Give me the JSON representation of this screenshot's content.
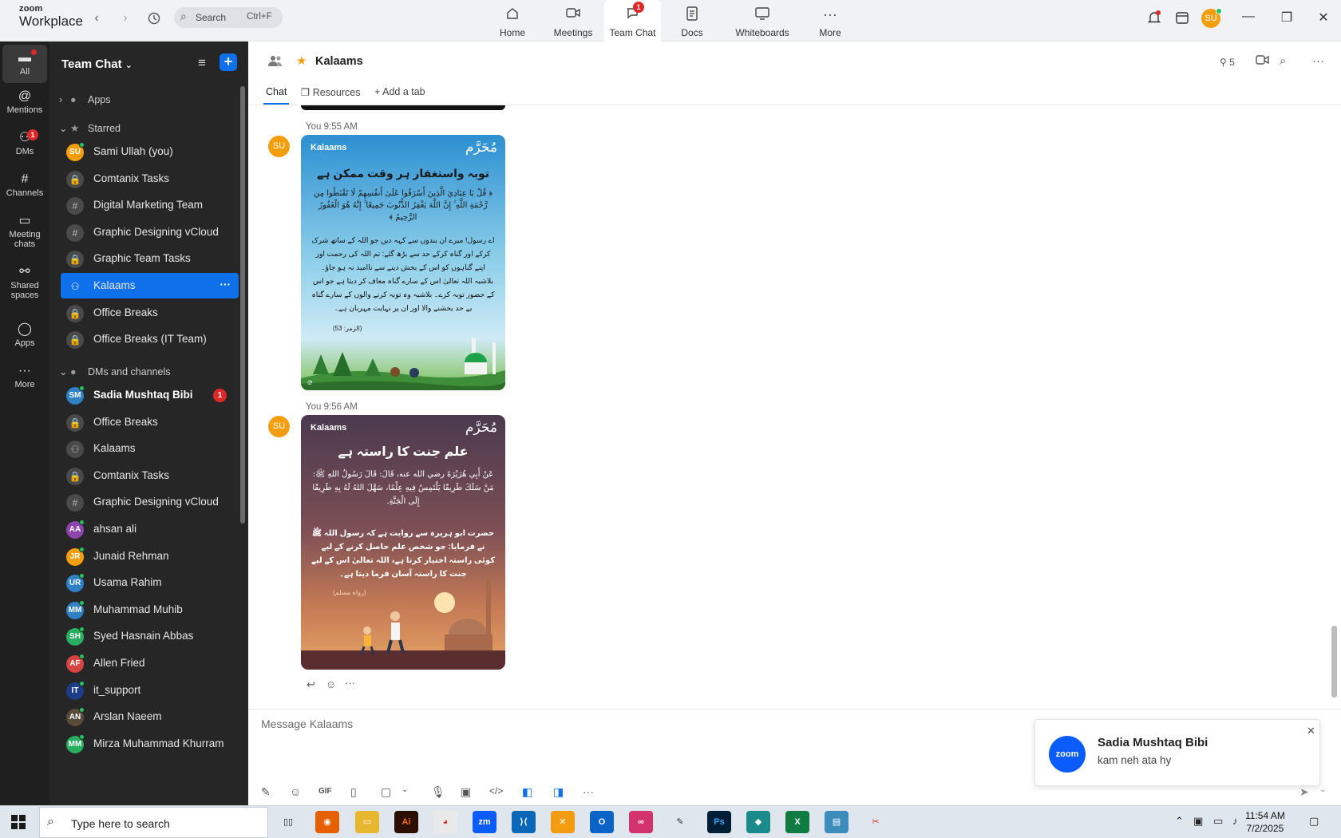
{
  "app": {
    "brand_top": "zoom",
    "brand_bottom": "Workplace"
  },
  "topbar": {
    "search_label": "Search",
    "search_shortcut": "Ctrl+F",
    "nav": [
      {
        "label": "Home",
        "icon": "home-icon"
      },
      {
        "label": "Meetings",
        "icon": "video-camera-icon"
      },
      {
        "label": "Team Chat",
        "icon": "chat-bubble-icon",
        "badge": "1",
        "active": true
      },
      {
        "label": "Docs",
        "icon": "document-icon"
      },
      {
        "label": "Whiteboards",
        "icon": "whiteboard-icon"
      },
      {
        "label": "More",
        "icon": "more-dots-icon"
      }
    ],
    "user_initials": "SU"
  },
  "rail": [
    {
      "label": "All",
      "icon": "chat-icon",
      "active": true
    },
    {
      "label": "Mentions",
      "icon": "at-icon"
    },
    {
      "label": "DMs",
      "icon": "people-icon",
      "badge": "1"
    },
    {
      "label": "Channels",
      "icon": "hash-icon"
    },
    {
      "label": "Meeting chats",
      "icon": "calendar-icon"
    },
    {
      "label": "Shared spaces",
      "icon": "shared-spaces-icon"
    },
    {
      "label": "Apps",
      "icon": "apps-icon"
    },
    {
      "label": "More",
      "icon": "more-icon"
    }
  ],
  "sidebar": {
    "title": "Team Chat",
    "sections": {
      "apps": "Apps",
      "starred": "Starred",
      "dms": "DMs and channels"
    },
    "starred": [
      {
        "name": "Sami Ullah (you)",
        "type": "avatar",
        "initials": "SU",
        "color": "#f59e0b"
      },
      {
        "name": "Comtanix Tasks",
        "type": "lock"
      },
      {
        "name": "Digital Marketing Team",
        "type": "hash"
      },
      {
        "name": "Graphic Designing vCloud",
        "type": "hash"
      },
      {
        "name": "Graphic Team Tasks",
        "type": "lock"
      },
      {
        "name": "Kalaams",
        "type": "group",
        "selected": true
      },
      {
        "name": "Office Breaks",
        "type": "lock"
      },
      {
        "name": "Office Breaks (IT Team)",
        "type": "lock"
      }
    ],
    "dms": [
      {
        "name": "Sadia Mushtaq Bibi",
        "type": "avatar",
        "initials": "SM",
        "color": "#2f80c4",
        "badge": "1",
        "bold": true
      },
      {
        "name": "Office Breaks",
        "type": "lock"
      },
      {
        "name": "Kalaams",
        "type": "group"
      },
      {
        "name": "Comtanix Tasks",
        "type": "lock"
      },
      {
        "name": "Graphic Designing vCloud",
        "type": "hash"
      },
      {
        "name": "ahsan ali",
        "type": "avatar",
        "initials": "AA",
        "color": "#8e44ad"
      },
      {
        "name": "Junaid Rehman",
        "type": "avatar",
        "initials": "JR",
        "color": "#f59e0b"
      },
      {
        "name": "Usama Rahim",
        "type": "avatar",
        "initials": "UR",
        "color": "#2f80c4"
      },
      {
        "name": "Muhammad Muhib",
        "type": "avatar",
        "initials": "MM",
        "color": "#2f80c4"
      },
      {
        "name": "Syed Hasnain Abbas",
        "type": "avatar",
        "initials": "SH",
        "color": "#27ae60"
      },
      {
        "name": "Allen Fried",
        "type": "avatar",
        "initials": "AF",
        "color": "#d64541"
      },
      {
        "name": "it_support",
        "type": "avatar",
        "initials": "IT",
        "color": "#1d3c8a"
      },
      {
        "name": "Arslan Naeem",
        "type": "avatar",
        "initials": "AN",
        "color": "#5a4a3a"
      },
      {
        "name": "Mirza Muhammad Khurram",
        "type": "avatar",
        "initials": "MM",
        "color": "#27ae60"
      }
    ]
  },
  "chat": {
    "name": "Kalaams",
    "members": "5",
    "tabs": [
      "Chat",
      "Resources",
      "Add a tab"
    ],
    "messages": [
      {
        "sender_initials": "SU",
        "meta": "You 9:55 AM",
        "card_tag": "Kalaams",
        "card_logo": "مُحَرَّم",
        "heading": "توبہ واستغفار ہر وقت ممکن ہے",
        "arabic": "﴿ قُلْ يَا عِبَادِيَ الَّذِينَ أَسْرَفُوا عَلَىٰ أَنفُسِهِمْ لَا تَقْنَطُوا مِن رَّحْمَةِ اللَّهِ ۚ إِنَّ اللَّهَ يَغْفِرُ الذُّنُوبَ جَمِيعًا ۚ إِنَّهُ هُوَ الْغَفُورُ الرَّحِيمُ ﴾",
        "urdu": "اے رسول! میرے ان بندوں سے کہہ دیں جو اللہ کے ساتھ شرک کرکے اور گناہ کرکے حد سے بڑھ گئے: تم اللہ کی رحمت اور اپنے گناہوں کو اس کے بخش دینے سے ناامید نہ ہو جاؤ۔ بلاشبہ اللہ تعالیٰ اس کے سارے گناہ معاف کر دیتا ہے جو اس کے حضور توبہ کرے۔ بلاشبہ وہ توبہ کرنے والوں کے سارے گناہ بے حد بخشنے والا اور ان پر نہایت مہربان ہے۔",
        "reference": "(الزمر: 53)"
      },
      {
        "sender_initials": "SU",
        "meta": "You 9:56 AM",
        "card_tag": "Kalaams",
        "card_logo": "مُحَرَّم",
        "heading": "علم جنت کا راستہ ہے",
        "arabic": "عَنْ أَبِي هُرَيْرَةَ رضي الله عنه، قَالَ: قَالَ رَسُولُ اللهِ ﷺ: مَنْ سَلَكَ طَرِيقًا يَلْتَمِسُ فِيهِ عِلْمًا، سَهَّلَ اللهُ لَهُ بِهِ طَرِيقًا إِلَى الْجَنَّةِ.",
        "urdu": "حضرت ابو ہریرہ سے روایت ہے کہ رسول اللہ ﷺ نے فرمایا: جو شخص علم حاصل کرنے کے لیے کوئی راستہ اختیار کرتا ہے، اللہ تعالیٰ اس کے لیے جنت کا راستہ آسان فرما دیتا ہے۔",
        "reference": "(رواہ مسلم)"
      }
    ]
  },
  "composer": {
    "placeholder": "Message Kalaams"
  },
  "toast": {
    "logo_text": "zoom",
    "name": "Sadia Mushtaq Bibi",
    "message": "kam neh ata hy"
  },
  "taskbar": {
    "search_placeholder": "Type here to search",
    "time": "11:54 AM",
    "date": "7/2/2025"
  }
}
